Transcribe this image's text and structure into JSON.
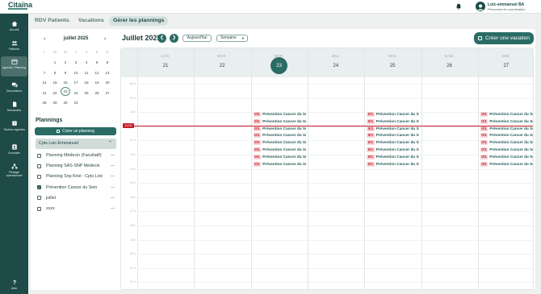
{
  "app": {
    "logo_text": "Citaïna"
  },
  "user": {
    "name": "Loic-emmanuel BA",
    "role": "Personnel de coordination"
  },
  "sidebar": {
    "items": [
      {
        "label": "Accueil",
        "icon": "home-icon"
      },
      {
        "label": "Patients",
        "icon": "users-icon"
      },
      {
        "label": "Agenda / Planning",
        "icon": "calendar-icon",
        "active": true
      },
      {
        "label": "Discussions",
        "icon": "chat-icon"
      },
      {
        "label": "Demandes",
        "icon": "document-icon"
      },
      {
        "label": "Tâ­ches urgentes",
        "icon": "alert-icon"
      },
      {
        "label": "Annuaire",
        "icon": "contacts-icon"
      },
      {
        "label": "Pilotage opérationnel",
        "icon": "network-icon"
      },
      {
        "label": "Aide",
        "icon": "help-icon"
      }
    ]
  },
  "tabs": [
    {
      "label": "RDV Patients"
    },
    {
      "label": "Vacations"
    },
    {
      "label": "Gérer les plannings",
      "active": true
    }
  ],
  "mini_calendar": {
    "title": "juillet 2025",
    "weekdays": [
      "L",
      "M",
      "M",
      "J",
      "V",
      "S",
      "D"
    ],
    "weeks": [
      [
        "",
        "1",
        "2",
        "3",
        "4",
        "5",
        "6"
      ],
      [
        "7",
        "8",
        "9",
        "10",
        "11",
        "12",
        "13"
      ],
      [
        "14",
        "15",
        "16",
        "17",
        "18",
        "19",
        "20"
      ],
      [
        "21",
        "22",
        "23",
        "24",
        "25",
        "26",
        "27"
      ],
      [
        "28",
        "29",
        "30",
        "31",
        "",
        "",
        ""
      ]
    ],
    "today": "23"
  },
  "plannings": {
    "title": "Plannings",
    "create_label": "Créer un planning",
    "group_label": "Cpts Loic-Emmanuel",
    "items": [
      {
        "label": "Planning Médecin (Facultatif)",
        "checked": false
      },
      {
        "label": "Planning SAS-SNP Médecin",
        "checked": false
      },
      {
        "label": "Planning Snp Kiné - Cpts Loic",
        "checked": false
      },
      {
        "label": "Prévention Cancer du Sein",
        "checked": true
      },
      {
        "label": "juillet",
        "checked": false
      },
      {
        "label": "xxxx",
        "checked": false
      }
    ]
  },
  "calendar": {
    "title": "Juillet 2025",
    "today_label": "Aujourd'hui",
    "view_label": "Semaine",
    "vacation_label": "Créer une vacation",
    "days": [
      {
        "name": "LUN.",
        "num": "21"
      },
      {
        "name": "MAR.",
        "num": "22"
      },
      {
        "name": "MER.",
        "num": "23",
        "current": true
      },
      {
        "name": "JEU.",
        "num": "24"
      },
      {
        "name": "VEN.",
        "num": "25"
      },
      {
        "name": "SAM.",
        "num": "26"
      },
      {
        "name": "DIM.",
        "num": "27"
      }
    ],
    "hours": [
      "08 h",
      "09 h",
      "10 h",
      "11 h",
      "12 h",
      "13 h",
      "14 h",
      "15 h",
      "16 h",
      "17 h",
      "18 h",
      "19 h",
      "20 h",
      "21 h",
      "22 h"
    ],
    "now_time": "10:00",
    "event": {
      "count": "0/1",
      "title": "Prévention Cancer du Sein"
    },
    "event_days": [
      2,
      4,
      6
    ],
    "event_rows": 8
  }
}
